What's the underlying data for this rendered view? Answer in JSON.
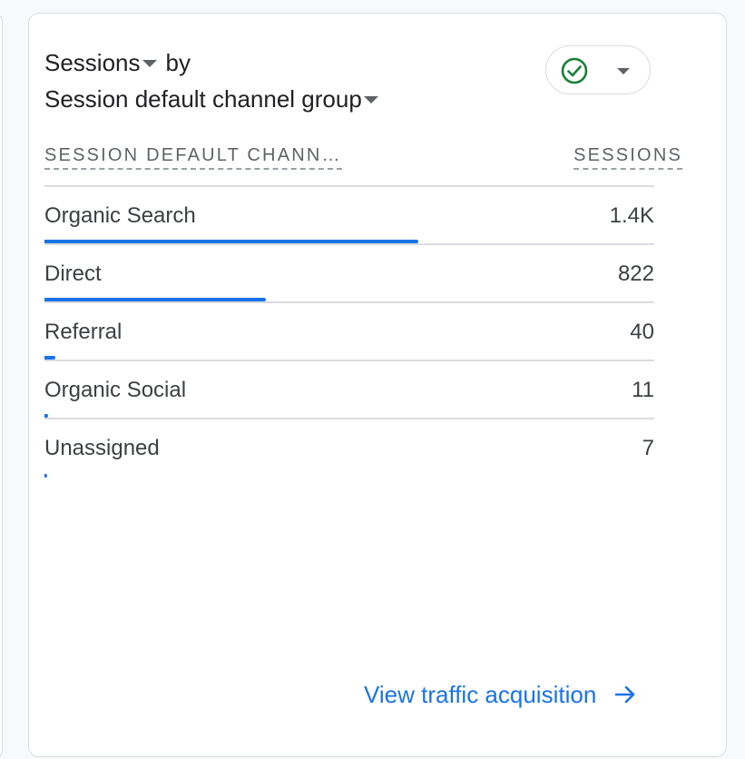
{
  "card": {
    "metric": "Sessions",
    "by": "by",
    "dimension": "Session default channel group",
    "status_icon": "check-circle-icon",
    "colors": {
      "accent": "#1a73e8",
      "status": "#188038"
    }
  },
  "table": {
    "headers": {
      "dimension": "SESSION DEFAULT CHANN…",
      "metric": "SESSIONS"
    },
    "rows": [
      {
        "label": "Organic Search",
        "value": "1.4K",
        "share": 0.613
      },
      {
        "label": "Direct",
        "value": "822",
        "share": 0.363
      },
      {
        "label": "Referral",
        "value": "40",
        "share": 0.018
      },
      {
        "label": "Organic Social",
        "value": "11",
        "share": 0.006
      },
      {
        "label": "Unassigned",
        "value": "7",
        "share": 0.003
      }
    ]
  },
  "footer": {
    "link_label": "View traffic acquisition",
    "link_icon": "arrow-forward-icon"
  }
}
